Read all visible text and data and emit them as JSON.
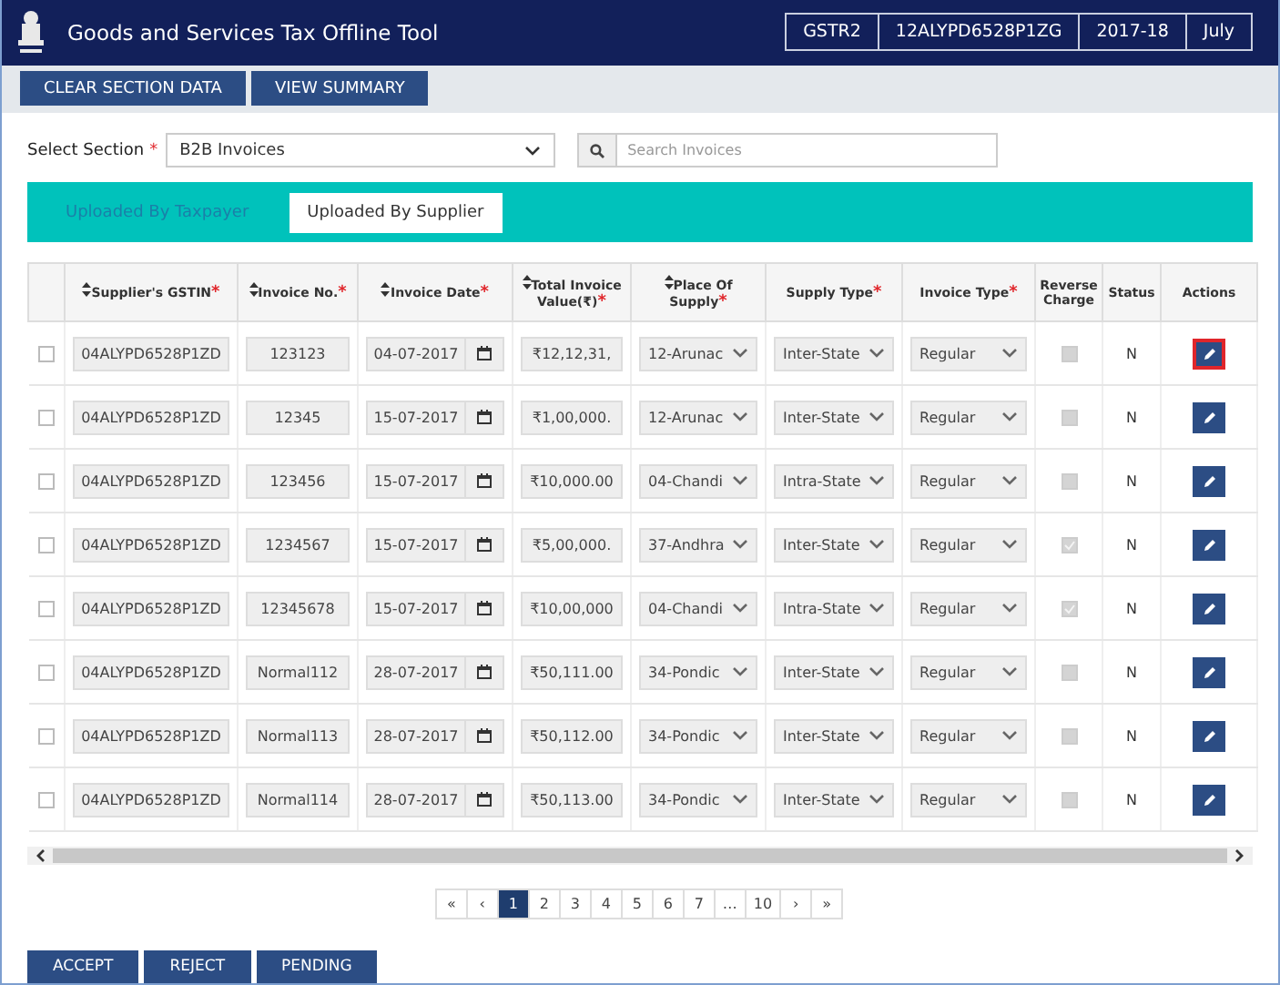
{
  "header": {
    "title": "Goods and Services Tax Offline Tool",
    "chips": [
      "GSTR2",
      "12ALYPD6528P1ZG",
      "2017-18",
      "July"
    ]
  },
  "toolbar": {
    "buttons": [
      "CLEAR SECTION DATA",
      "VIEW SUMMARY"
    ]
  },
  "section": {
    "label": "Select Section",
    "required_mark": "*",
    "value": "B2B Invoices"
  },
  "search": {
    "placeholder": "Search Invoices"
  },
  "tabs": [
    {
      "label": "Uploaded By Taxpayer",
      "selected": false
    },
    {
      "label": "Uploaded By Supplier",
      "selected": true
    }
  ],
  "table": {
    "columns": [
      {
        "label": "Supplier's GSTIN",
        "sortable": true,
        "required_mark": "*"
      },
      {
        "label": "Invoice No.",
        "sortable": true,
        "required_mark": "*"
      },
      {
        "label": "Invoice Date",
        "sortable": true,
        "required_mark": "*"
      },
      {
        "label": "Total Invoice Value(₹)",
        "sortable": true,
        "required_mark": "*"
      },
      {
        "label": "Place Of Supply",
        "sortable": true,
        "required_mark": "*"
      },
      {
        "label": "Supply Type",
        "sortable": false,
        "required_mark": "*"
      },
      {
        "label": "Invoice Type",
        "sortable": false,
        "required_mark": "*"
      },
      {
        "label": "Reverse Charge",
        "sortable": false
      },
      {
        "label": "Status",
        "sortable": false
      },
      {
        "label": "Actions",
        "sortable": false
      }
    ],
    "rows": [
      {
        "checked": false,
        "gstin": "04ALYPD6528P1ZD",
        "invoice_no": "123123",
        "invoice_date": "04-07-2017",
        "value": "₹12,12,31,",
        "place": "12-Arunac",
        "supply_type": "Inter-State",
        "invoice_type": "Regular",
        "reverse_charge": false,
        "status": "N",
        "edit_highlighted": true
      },
      {
        "checked": false,
        "gstin": "04ALYPD6528P1ZD",
        "invoice_no": "12345",
        "invoice_date": "15-07-2017",
        "value": "₹1,00,000.",
        "place": "12-Arunac",
        "supply_type": "Inter-State",
        "invoice_type": "Regular",
        "reverse_charge": false,
        "status": "N",
        "edit_highlighted": false
      },
      {
        "checked": false,
        "gstin": "04ALYPD6528P1ZD",
        "invoice_no": "123456",
        "invoice_date": "15-07-2017",
        "value": "₹10,000.00",
        "place": "04-Chandi",
        "supply_type": "Intra-State",
        "invoice_type": "Regular",
        "reverse_charge": false,
        "status": "N",
        "edit_highlighted": false
      },
      {
        "checked": false,
        "gstin": "04ALYPD6528P1ZD",
        "invoice_no": "1234567",
        "invoice_date": "15-07-2017",
        "value": "₹5,00,000.",
        "place": "37-Andhra",
        "supply_type": "Inter-State",
        "invoice_type": "Regular",
        "reverse_charge": true,
        "status": "N",
        "edit_highlighted": false
      },
      {
        "checked": false,
        "gstin": "04ALYPD6528P1ZD",
        "invoice_no": "12345678",
        "invoice_date": "15-07-2017",
        "value": "₹10,00,000",
        "place": "04-Chandi",
        "supply_type": "Intra-State",
        "invoice_type": "Regular",
        "reverse_charge": true,
        "status": "N",
        "edit_highlighted": false
      },
      {
        "checked": false,
        "gstin": "04ALYPD6528P1ZD",
        "invoice_no": "Normal112",
        "invoice_date": "28-07-2017",
        "value": "₹50,111.00",
        "place": "34-Pondic",
        "supply_type": "Inter-State",
        "invoice_type": "Regular",
        "reverse_charge": false,
        "status": "N",
        "edit_highlighted": false
      },
      {
        "checked": false,
        "gstin": "04ALYPD6528P1ZD",
        "invoice_no": "Normal113",
        "invoice_date": "28-07-2017",
        "value": "₹50,112.00",
        "place": "34-Pondic",
        "supply_type": "Inter-State",
        "invoice_type": "Regular",
        "reverse_charge": false,
        "status": "N",
        "edit_highlighted": false
      },
      {
        "checked": false,
        "gstin": "04ALYPD6528P1ZD",
        "invoice_no": "Normal114",
        "invoice_date": "28-07-2017",
        "value": "₹50,113.00",
        "place": "34-Pondic",
        "supply_type": "Inter-State",
        "invoice_type": "Regular",
        "reverse_charge": false,
        "status": "N",
        "edit_highlighted": false
      }
    ]
  },
  "pagination": [
    {
      "label": "«",
      "selected": false
    },
    {
      "label": "‹",
      "selected": false
    },
    {
      "label": "1",
      "selected": true
    },
    {
      "label": "2",
      "selected": false
    },
    {
      "label": "3",
      "selected": false
    },
    {
      "label": "4",
      "selected": false
    },
    {
      "label": "5",
      "selected": false
    },
    {
      "label": "6",
      "selected": false
    },
    {
      "label": "7",
      "selected": false
    },
    {
      "label": "…",
      "selected": false
    },
    {
      "label": "10",
      "selected": false
    },
    {
      "label": "›",
      "selected": false
    },
    {
      "label": "»",
      "selected": false
    }
  ],
  "actions": [
    "ACCEPT",
    "REJECT",
    "PENDING"
  ]
}
